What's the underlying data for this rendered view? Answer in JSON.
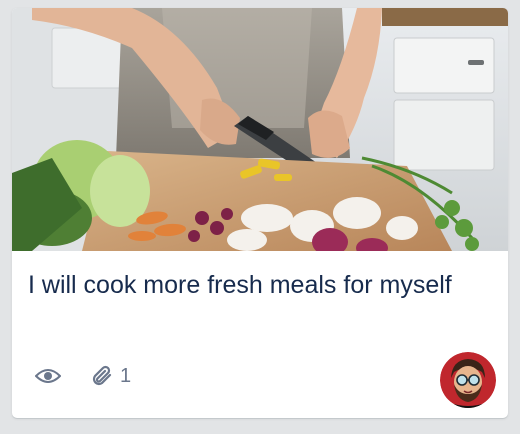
{
  "card": {
    "title": "I will cook more fresh meals for myself",
    "cover_image": "person chopping vegetables on a cutting board",
    "badges": {
      "watch_icon": "eye-icon",
      "attachment_icon": "paperclip-icon",
      "attachment_count": "1"
    },
    "member_avatar": "cartoon avatar of man with glasses and beard"
  },
  "colors": {
    "card_background": "#ffffff",
    "board_background": "#e2e4e6",
    "title_text": "#172b4d",
    "badge_text": "#6b778c",
    "avatar_ring": "#c0272d"
  }
}
